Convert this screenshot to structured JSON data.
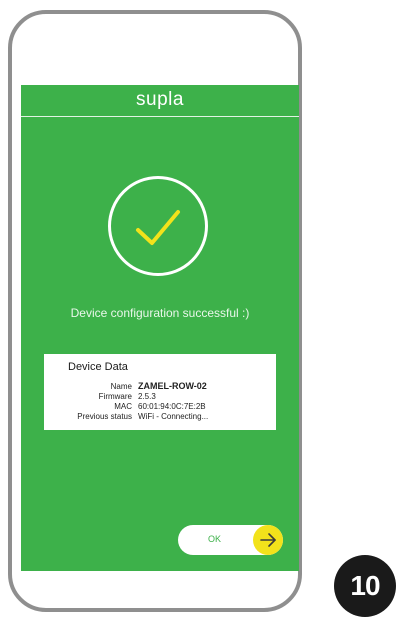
{
  "app": {
    "title": "supla"
  },
  "status": {
    "message": "Device configuration successful :)"
  },
  "device_data": {
    "title": "Device Data",
    "fields": [
      {
        "label": "Name",
        "value": "ZAMEL-ROW-02"
      },
      {
        "label": "Firmware",
        "value": "2.5.3"
      },
      {
        "label": "MAC",
        "value": "60:01:94:0C:7E:2B"
      },
      {
        "label": "Previous status",
        "value": "WiFi - Connecting..."
      }
    ]
  },
  "ok_button": {
    "label": "OK"
  },
  "step": {
    "number": "10"
  },
  "colors": {
    "screen_green": "#3db14a",
    "accent_yellow": "#f2e21b",
    "badge_black": "#1a1a1a"
  },
  "icons": [
    "check-icon",
    "arrow-right-icon"
  ]
}
